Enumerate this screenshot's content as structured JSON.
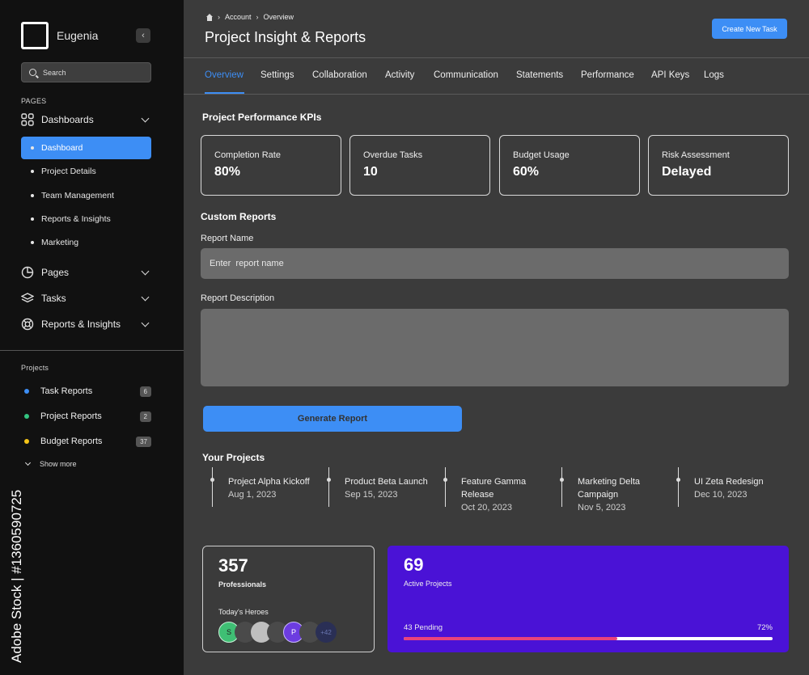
{
  "sidebar": {
    "brand": "Eugenia",
    "search_placeholder": "Search",
    "pages_label": "PAGES",
    "groups": [
      {
        "label": "Dashboards",
        "icon": "grid-icon"
      },
      {
        "label": "Pages",
        "icon": "pie-chart-icon"
      },
      {
        "label": "Tasks",
        "icon": "stack-icon"
      },
      {
        "label": "Reports & Insights",
        "icon": "lifebuoy-icon"
      }
    ],
    "dashboard_items": [
      "Dashboard",
      "Project Details",
      "Team Management",
      "Reports & Insights",
      "Marketing"
    ],
    "projects_label": "Projects",
    "projects": [
      {
        "label": "Task Reports",
        "count": "6",
        "color": "#3d8ef5"
      },
      {
        "label": "Project Reports",
        "count": "2",
        "color": "#33c481"
      },
      {
        "label": "Budget Reports",
        "count": "37",
        "color": "#f5c518"
      }
    ],
    "show_more": "Show more"
  },
  "watermark_side": "Adobe Stock | #1360590725",
  "header": {
    "breadcrumb": [
      "Account",
      "Overview"
    ],
    "title": "Project Insight & Reports",
    "create_button": "Create New Task"
  },
  "tabs": [
    "Overview",
    "Settings",
    "Collaboration",
    "Activity",
    "Communication",
    "Statements",
    "Performance",
    "API Keys",
    "Logs"
  ],
  "kpi_section": {
    "title": "Project Performance KPIs",
    "cards": [
      {
        "label": "Completion Rate",
        "value": "80%"
      },
      {
        "label": "Overdue Tasks",
        "value": "10"
      },
      {
        "label": "Budget Usage",
        "value": "60%"
      },
      {
        "label": "Risk Assessment",
        "value": "Delayed"
      }
    ]
  },
  "custom_reports": {
    "title": "Custom Reports",
    "name_label": "Report Name",
    "name_placeholder": "Enter  report name",
    "desc_label": "Report Description",
    "generate_button": "Generate Report"
  },
  "your_projects": {
    "title": "Your Projects",
    "items": [
      {
        "name": "Project Alpha Kickoff",
        "date": "Aug 1, 2023"
      },
      {
        "name": "Product Beta Launch",
        "date": "Sep 15, 2023"
      },
      {
        "name": "Feature Gamma Release",
        "date": "Oct 20, 2023"
      },
      {
        "name": "Marketing Delta Campaign",
        "date": "Nov 5, 2023"
      },
      {
        "name": "UI Zeta Redesign",
        "date": "Dec 10, 2023"
      }
    ]
  },
  "professionals": {
    "count": "357",
    "label": "Professionals",
    "heroes_label": "Today's Heroes",
    "avatars": [
      {
        "initial": "S",
        "color": "#3fbf74"
      },
      {
        "initial": "",
        "color": "#bfbfbf"
      },
      {
        "initial": "P",
        "color": "#6c3ce0"
      },
      {
        "initial": "+42",
        "color": "#2a2f55"
      }
    ]
  },
  "active_projects": {
    "count": "69",
    "label": "Active Projects",
    "pending": "43 Pending",
    "percent_label": "72%",
    "progress": 0.58
  },
  "colors": {
    "accent": "#3d8ef5",
    "purple_card": "#4a12d6",
    "progress_fill": "#e9437c"
  }
}
